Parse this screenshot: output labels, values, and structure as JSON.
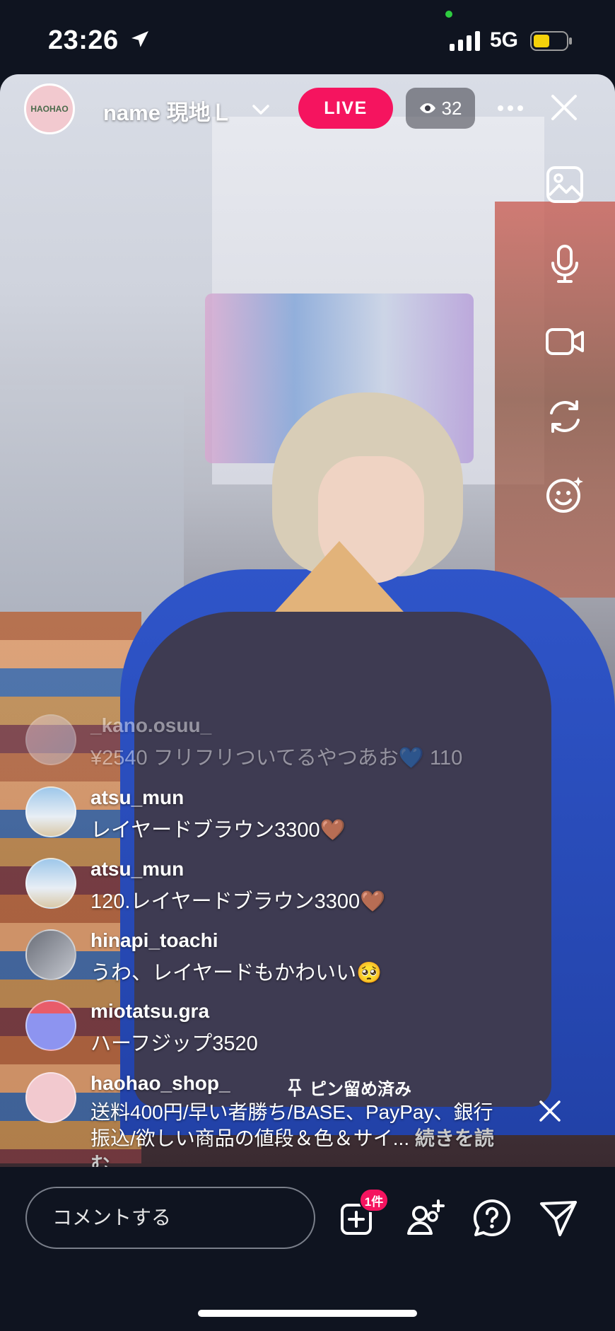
{
  "status_bar": {
    "time": "23:26",
    "network": "5G"
  },
  "live_header": {
    "host_name": "name 現地Ｌ",
    "host_avatar_text": "HAOHAO",
    "live_label": "LIVE",
    "viewer_count": "32"
  },
  "comments": [
    {
      "user": "_kano.osuu_",
      "text": "¥2540  フリフリついてるやつあお💙     110",
      "faded": true
    },
    {
      "user": "atsu_mun",
      "text": "レイヤードブラウン3300🤎"
    },
    {
      "user": "atsu_mun",
      "text": "120.レイヤードブラウン3300🤎"
    },
    {
      "user": "hinapi_toachi",
      "text": "うわ、レイヤードもかわいい🥺"
    },
    {
      "user": "miotatsu.gra",
      "text": "ハーフジップ3520"
    }
  ],
  "pinned": {
    "user": "haohao_shop_",
    "pin_label": "ピン留め済み",
    "text": "送料400円/早い者勝ち/BASE、PayPay、銀行振込/欲しい商品の値段＆色＆サイ...",
    "read_more": "続きを読む"
  },
  "bottom_bar": {
    "comment_placeholder": "コメントする",
    "badge_text": "1件"
  },
  "icons": {
    "right_rail": [
      "gallery-icon",
      "microphone-icon",
      "video-camera-icon",
      "flip-camera-icon",
      "effects-icon"
    ],
    "bottom": [
      "add-shop-icon",
      "add-guest-icon",
      "question-icon",
      "send-icon"
    ]
  },
  "colors": {
    "live": "#f5145f",
    "background": "#0f1420"
  }
}
